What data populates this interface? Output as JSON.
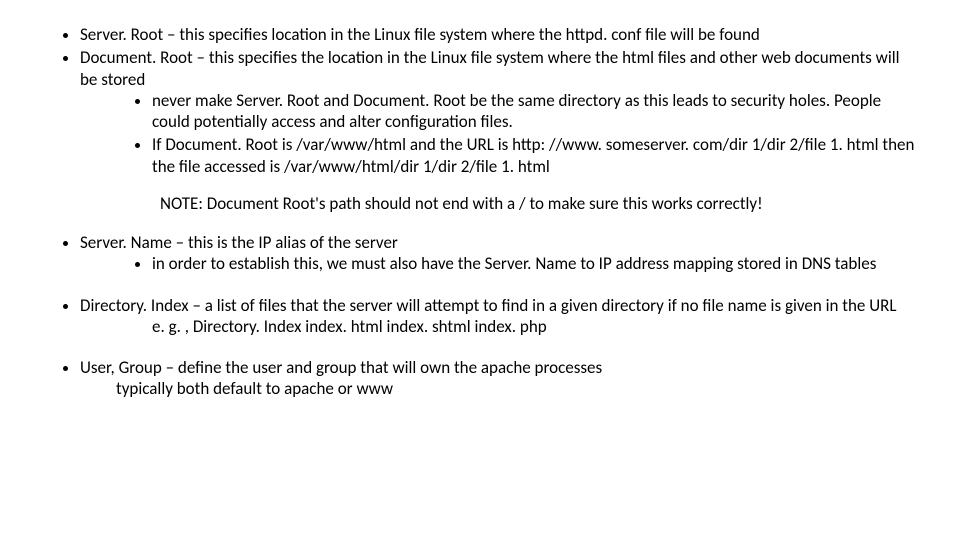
{
  "b1": {
    "text": "Server. Root – this specifies location in the Linux file system where the httpd. conf file will be found"
  },
  "b2": {
    "text": "Document. Root – this specifies the location in the Linux file system where the html files and other web documents will be stored",
    "s1": "never make Server. Root and Document. Root be the same directory as this leads to security holes. People could potentially access and alter configuration files.",
    "s2": "If Document. Root is /var/www/html and the URL is http: //www. someserver. com/dir 1/dir 2/file 1. html then the file accessed is /var/www/html/dir 1/dir 2/file 1. html"
  },
  "note": "NOTE:  Document Root's path should not end with a / to make sure this works correctly!",
  "b3": {
    "text": "Server. Name – this is the IP alias of the server",
    "s1": "in order to establish this, we must also have the Server. Name to IP address mapping stored in DNS tables"
  },
  "b4": {
    "text": "Directory. Index – a list of files that the server will attempt to find in a given directory if no file name is given in the URL",
    "eg": "e. g. , Directory. Index index. html index. shtml index. php"
  },
  "b5": {
    "text": "User, Group – define the user and group that will own the apache processes",
    "sub": "typically both default to apache or www"
  }
}
